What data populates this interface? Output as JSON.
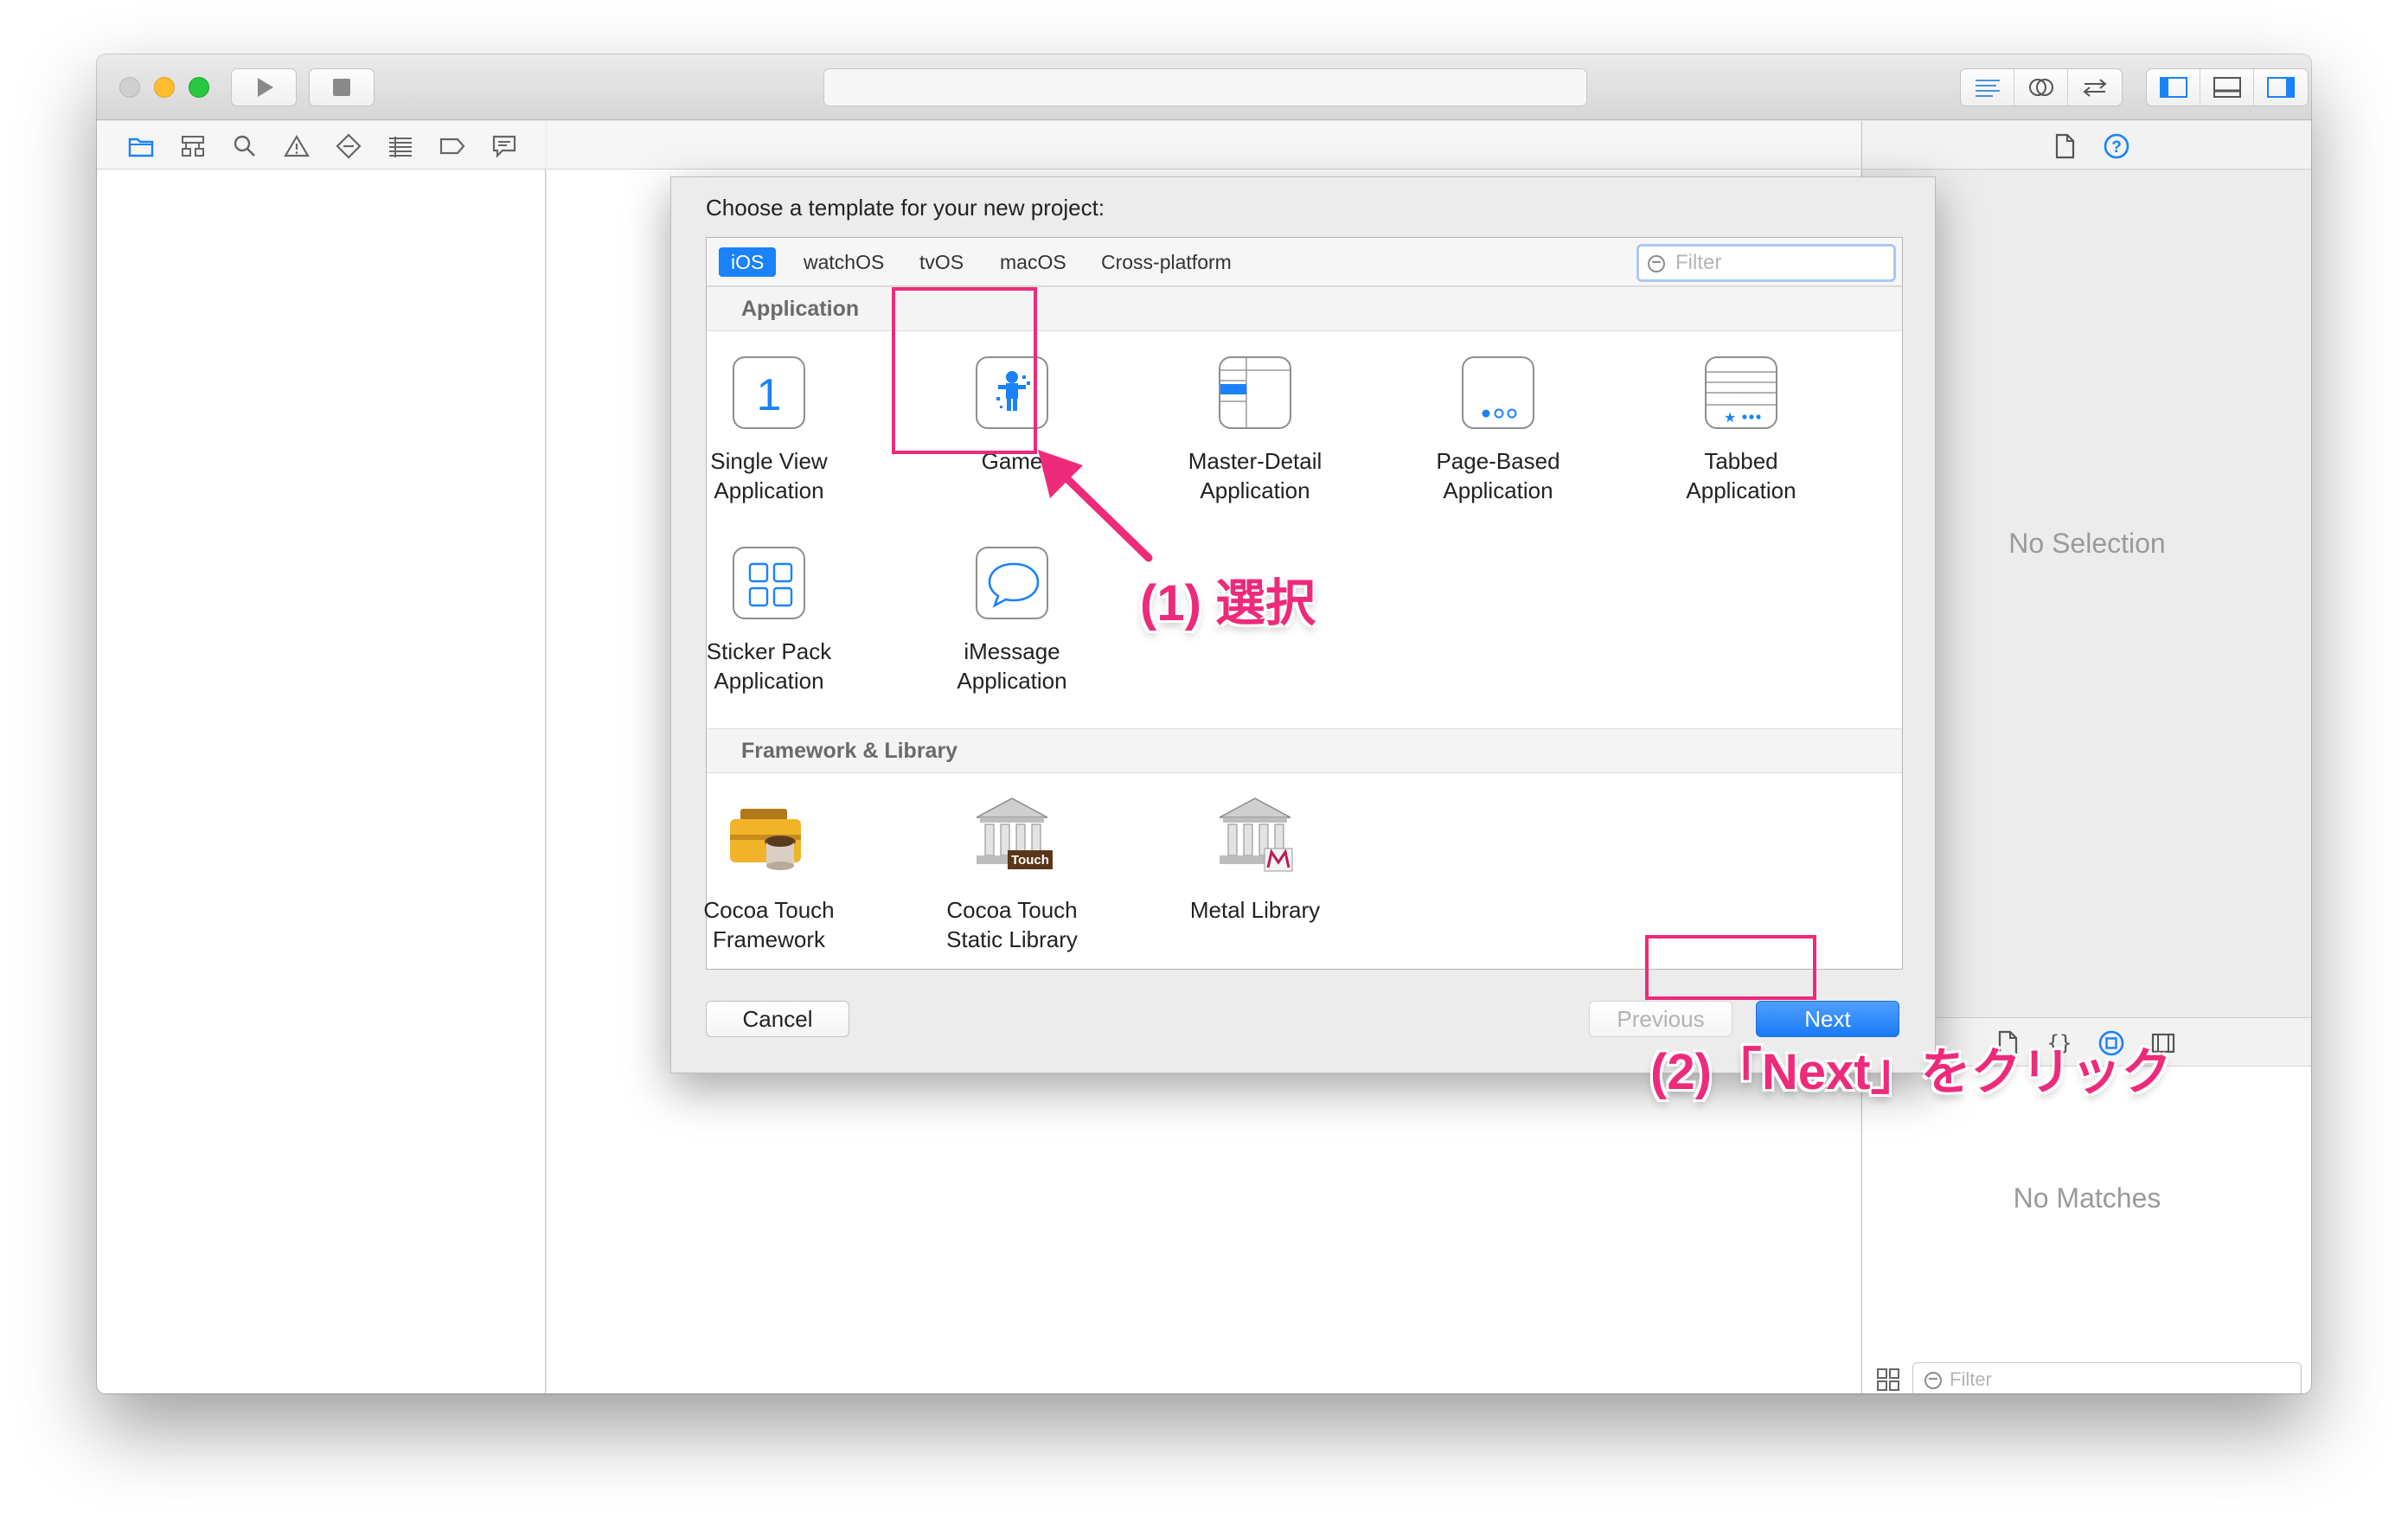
{
  "colors": {
    "accent": "#1a82fb",
    "annotation": "#ee2a7b",
    "icon_blue": "#1a82fb"
  },
  "window": {
    "toolbar": {
      "run_icon": "play-icon",
      "stop_icon": "stop-icon",
      "editor_segments": [
        "standard-editor-icon",
        "assistant-editor-icon",
        "version-editor-icon"
      ],
      "view_segments": [
        "navigator-toggle-icon",
        "debug-area-toggle-icon",
        "utilities-toggle-icon"
      ]
    },
    "navigator": {
      "icons": [
        "folder-icon",
        "hierarchy-icon",
        "search-icon",
        "warning-icon",
        "test-icon",
        "debug-icon",
        "breakpoint-icon",
        "report-icon"
      ]
    },
    "inspector": {
      "icons": [
        "file-icon",
        "help-icon"
      ],
      "no_selection": "No Selection",
      "library_icons": [
        "file-template-icon",
        "code-snippet-icon",
        "object-library-icon",
        "media-library-icon"
      ],
      "no_matches": "No Matches",
      "filter_placeholder": "Filter"
    }
  },
  "sheet": {
    "title": "Choose a template for your new project:",
    "tabs": [
      "iOS",
      "watchOS",
      "tvOS",
      "macOS",
      "Cross-platform"
    ],
    "active_tab": "iOS",
    "filter_placeholder": "Filter",
    "sections": [
      {
        "name": "Application",
        "templates": [
          {
            "label": "Single View\nApplication",
            "icon": "single-view-icon"
          },
          {
            "label": "Game",
            "icon": "game-icon"
          },
          {
            "label": "Master-Detail\nApplication",
            "icon": "master-detail-icon"
          },
          {
            "label": "Page-Based\nApplication",
            "icon": "page-based-icon"
          },
          {
            "label": "Tabbed\nApplication",
            "icon": "tabbed-icon"
          },
          {
            "label": "Sticker Pack\nApplication",
            "icon": "sticker-pack-icon"
          },
          {
            "label": "iMessage\nApplication",
            "icon": "imessage-icon"
          }
        ]
      },
      {
        "name": "Framework & Library",
        "templates": [
          {
            "label": "Cocoa Touch\nFramework",
            "icon": "toolbox-icon"
          },
          {
            "label": "Cocoa Touch\nStatic Library",
            "icon": "library-building-icon",
            "badge": "Touch"
          },
          {
            "label": "Metal Library",
            "icon": "metal-library-icon"
          }
        ]
      }
    ],
    "buttons": {
      "cancel": "Cancel",
      "previous": "Previous",
      "next": "Next"
    }
  },
  "annotations": {
    "step1": "(1) 選択",
    "step2": "(2)「Next」をクリック"
  }
}
